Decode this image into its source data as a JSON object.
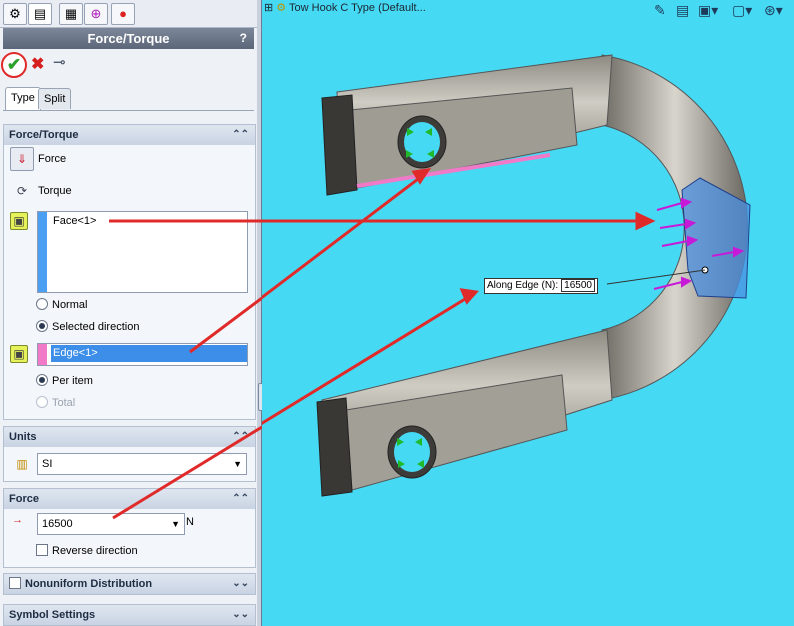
{
  "window": {
    "title": "Force/Torque",
    "help": "?"
  },
  "panel_tabs": [
    "property-manager-icon",
    "feature-manager-icon",
    "configuration-icon",
    "target-icon",
    "display-icon"
  ],
  "actions": {
    "ok": "✔",
    "cancel": "✖"
  },
  "tabs": [
    {
      "label": "Type",
      "active": true
    },
    {
      "label": "Split",
      "active": false
    }
  ],
  "force_torque": {
    "header": "Force/Torque",
    "force_label": "Force",
    "torque_label": "Torque",
    "faces_value": "Face<1>",
    "normal_label": "Normal",
    "selected_direction_label": "Selected direction",
    "edge_value": "Edge<1>",
    "per_item_label": "Per item",
    "total_label": "Total"
  },
  "units": {
    "header": "Units",
    "value": "SI"
  },
  "force": {
    "header": "Force",
    "value": "16500",
    "unit": "N",
    "reverse_label": "Reverse direction"
  },
  "nonuniform": {
    "header": "Nonuniform Distribution"
  },
  "symbol": {
    "header": "Symbol Settings"
  },
  "viewport": {
    "tree_label": "Tow Hook C Type  (Default...",
    "callout_label": "Along Edge (N):",
    "callout_value": "16500"
  },
  "colors": {
    "viewport_bg": "#46d9f3",
    "accent_red": "#e02a2a",
    "arrow_magenta": "#c71ad8"
  }
}
